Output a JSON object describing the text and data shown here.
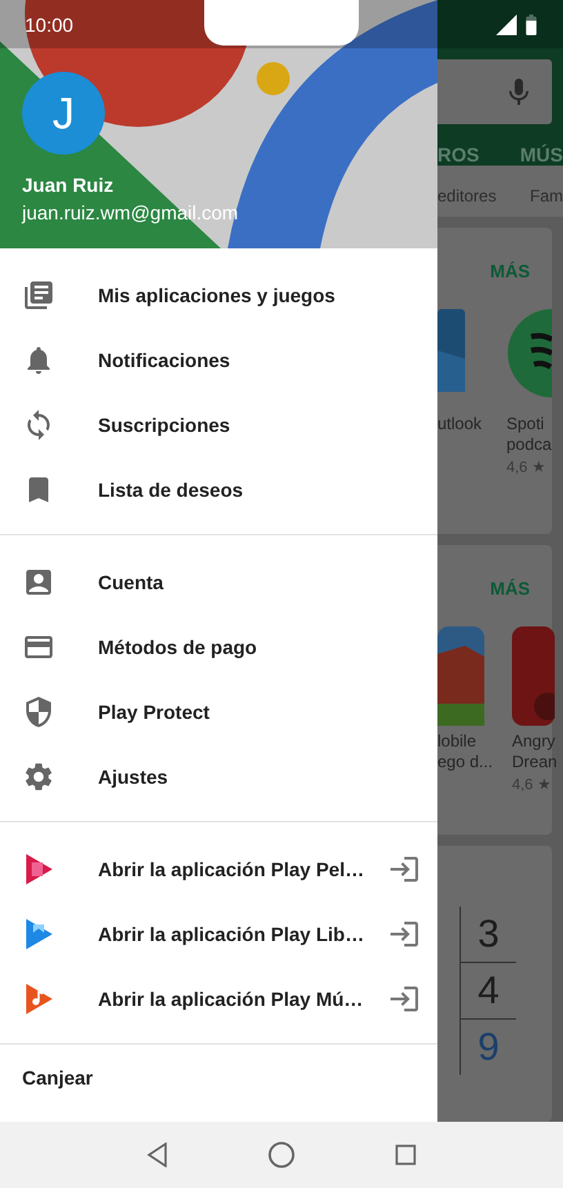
{
  "status_bar": {
    "time": "10:00"
  },
  "account": {
    "initial": "J",
    "name": "Juan Ruiz",
    "email": "juan.ruiz.wm@gmail.com"
  },
  "menu_sections": [
    [
      {
        "label": "Mis aplicaciones y juegos"
      },
      {
        "label": "Notificaciones"
      },
      {
        "label": "Suscripciones"
      },
      {
        "label": "Lista de deseos"
      }
    ],
    [
      {
        "label": "Cuenta"
      },
      {
        "label": "Métodos de pago"
      },
      {
        "label": "Play Protect"
      },
      {
        "label": "Ajustes"
      }
    ],
    [
      {
        "label": "Abrir la aplicación Play Pel…",
        "external": true
      },
      {
        "label": "Abrir la aplicación Play Lib…",
        "external": true
      },
      {
        "label": "Abrir la aplicación Play Mú…",
        "external": true
      }
    ]
  ],
  "redeem": "Canjear",
  "background": {
    "tabs": [
      "ROS",
      "MÚS"
    ],
    "chips": [
      "editores",
      "Fam"
    ],
    "cards": [
      {
        "action": "MÁS",
        "apps": [
          {
            "lines": [
              "utlook"
            ]
          },
          {
            "lines": [
              "Spoti",
              "podca"
            ],
            "rating": "4,6 ★"
          }
        ]
      },
      {
        "action": "MÁS",
        "apps": [
          {
            "lines": [
              "lobile",
              "ego d..."
            ]
          },
          {
            "lines": [
              "Angry",
              "Drean"
            ],
            "rating": "4,6 ★"
          }
        ]
      }
    ],
    "numbers": [
      "3",
      "4",
      "9"
    ]
  }
}
